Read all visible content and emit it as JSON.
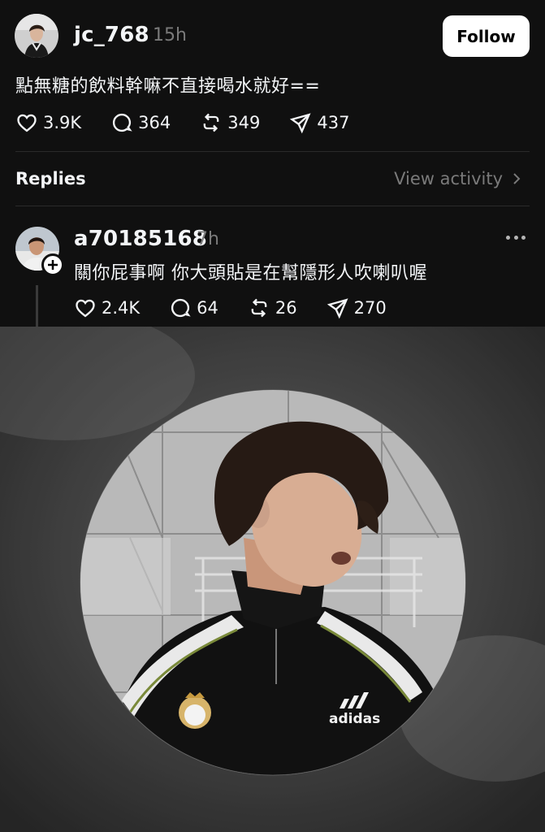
{
  "post": {
    "username": "jc_768",
    "time": "15h",
    "follow_label": "Follow",
    "text": "點無糖的飲料幹嘛不直接喝水就好==",
    "likes": "3.9K",
    "comments": "364",
    "reposts": "349",
    "shares": "437"
  },
  "replies_bar": {
    "title": "Replies",
    "view_activity": "View activity"
  },
  "reply": {
    "username": "a70185168",
    "time": "7h",
    "text": "關你屁事啊 你大頭貼是在幫隱形人吹喇叭喔",
    "likes": "2.4K",
    "comments": "64",
    "reposts": "26",
    "shares": "270"
  },
  "icons": {
    "like": "heart-icon",
    "comment": "comment-icon",
    "repost": "repost-icon",
    "share": "send-icon",
    "more": "more-icon",
    "chevron": "chevron-right-icon",
    "follow_badge": "plus-icon"
  },
  "colors": {
    "background": "#101010",
    "text_primary": "#f3f5f7",
    "text_secondary": "#7a7a7a",
    "follow_button": "#ffffff"
  }
}
